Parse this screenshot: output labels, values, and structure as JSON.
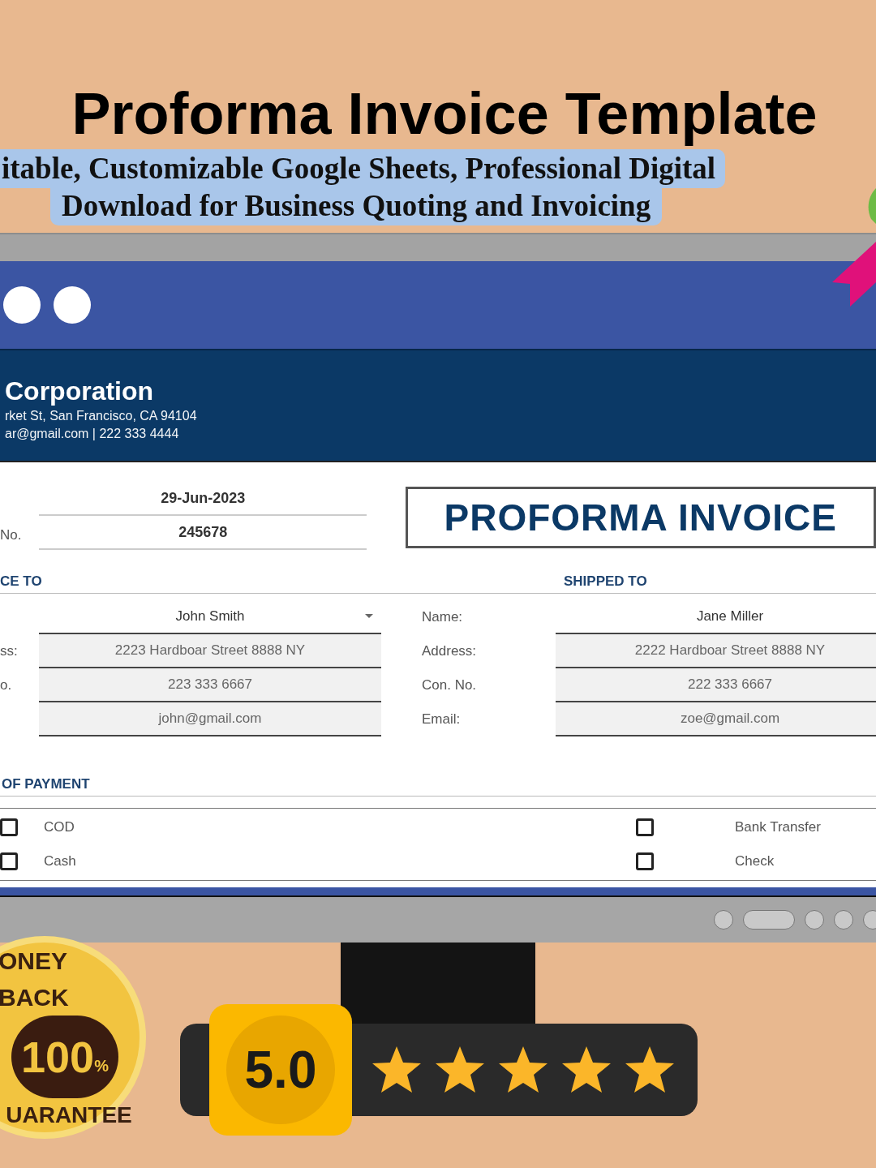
{
  "header": {
    "title": "Proforma Invoice Template",
    "subtitle_lines": [
      "itable, Customizable Google Sheets, Professional Digital",
      "Download for Business Quoting and Invoicing"
    ]
  },
  "company": {
    "name": "Corporation",
    "address": "rket St, San Francisco, CA 94104",
    "contact": "ar@gmail.com | 222 333 4444"
  },
  "meta": [
    {
      "value": "29-Jun-2023"
    },
    {
      "label": "No.",
      "value": "245678"
    }
  ],
  "document_title": "PROFORMA INVOICE",
  "bill_to": {
    "heading": "CE TO",
    "rows": [
      {
        "kind": "dropdown",
        "value": "John Smith"
      },
      {
        "kind": "field",
        "label": "ss:",
        "value": "2223 Hardboar Street 8888 NY"
      },
      {
        "kind": "field",
        "label": "o.",
        "value": "223 333 6667"
      },
      {
        "kind": "field",
        "value": "john@gmail.com"
      }
    ]
  },
  "shipped_to": {
    "heading": "SHIPPED TO",
    "rows": [
      {
        "kind": "plain",
        "label": "Name:",
        "value": "Jane Miller"
      },
      {
        "kind": "field",
        "label": "Address:",
        "value": "2222 Hardboar Street 8888 NY"
      },
      {
        "kind": "field",
        "label": "Con. No.",
        "value": "222 333 6667"
      },
      {
        "kind": "field",
        "label": "Email:",
        "value": "zoe@gmail.com"
      }
    ]
  },
  "payment": {
    "heading": "OF PAYMENT",
    "options": [
      {
        "label": "COD",
        "checked": false
      },
      {
        "label": "Bank Transfer",
        "checked": false
      },
      {
        "label": "Cash",
        "checked": false
      },
      {
        "label": "Check",
        "checked": false
      }
    ]
  },
  "badge": {
    "top": "ONEY BACK",
    "number": "100",
    "unit": "%",
    "bottom": "UARANTEE"
  },
  "rating": {
    "score": "5.0",
    "stars": 5
  }
}
